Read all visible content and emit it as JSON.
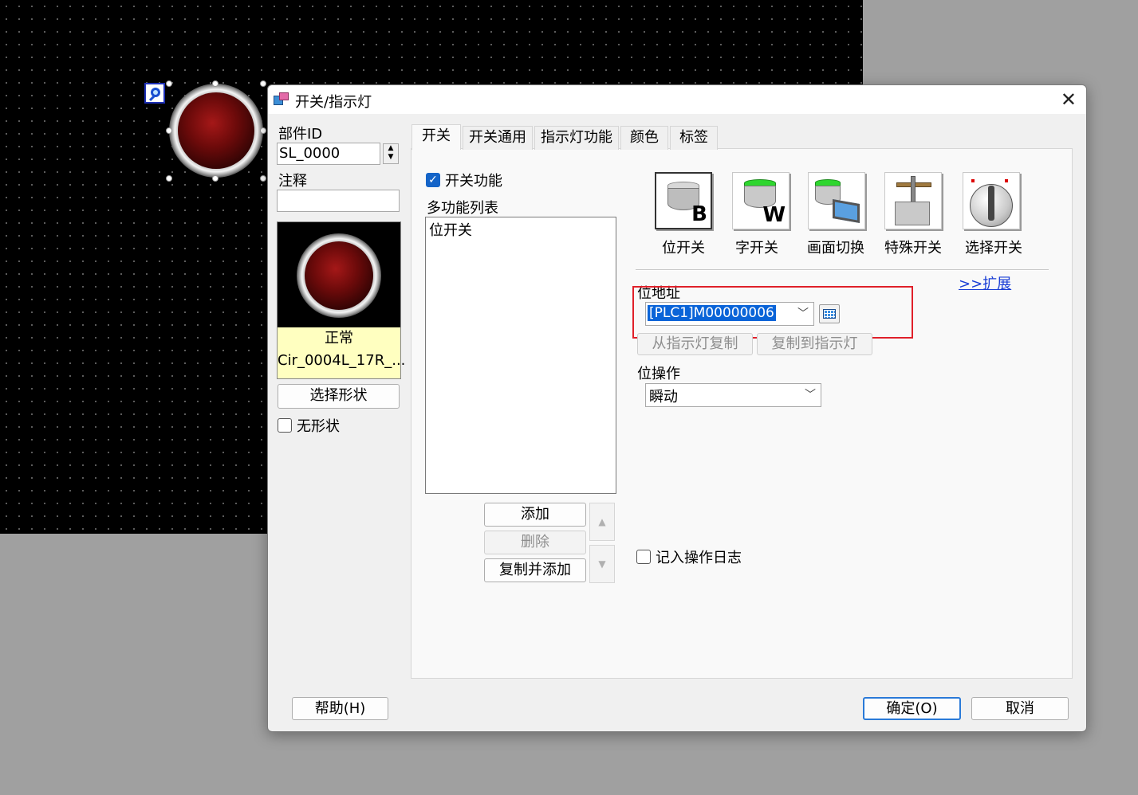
{
  "dialog": {
    "title": "开关/指示灯",
    "close_glyph": "✕"
  },
  "left_panel": {
    "part_id_label": "部件ID",
    "part_id_value": "SL_0000",
    "comment_label": "注释",
    "comment_value": "",
    "preview_state": "正常",
    "preview_shape_name": "Cir_0004L_17R_...",
    "select_shape_label": "选择形状",
    "no_shape_label": "无形状",
    "no_shape_checked": false
  },
  "tabs": [
    {
      "label": "开关",
      "active": true
    },
    {
      "label": "开关通用",
      "active": false
    },
    {
      "label": "指示灯功能",
      "active": false
    },
    {
      "label": "颜色",
      "active": false
    },
    {
      "label": "标签",
      "active": false
    }
  ],
  "switch_tab": {
    "switch_function_label": "开关功能",
    "switch_function_checked": true,
    "multi_function_list_label": "多功能列表",
    "list_items": [
      "位开关"
    ],
    "add_label": "添加",
    "delete_label": "删除",
    "copy_add_label": "复制并添加",
    "switch_types": [
      {
        "label": "位开关",
        "icon": "bit-switch-icon",
        "letter": "B",
        "selected": true
      },
      {
        "label": "字开关",
        "icon": "word-switch-icon",
        "letter": "W",
        "selected": false
      },
      {
        "label": "画面切换",
        "icon": "screen-change-icon",
        "letter": "",
        "selected": false
      },
      {
        "label": "特殊开关",
        "icon": "special-switch-icon",
        "letter": "",
        "selected": false
      },
      {
        "label": "选择开关",
        "icon": "selector-switch-icon",
        "letter": "",
        "selected": false
      }
    ],
    "expand_link": ">>扩展",
    "bit_address_label": "位地址",
    "bit_address_value": "[PLC1]M00000006",
    "copy_from_lamp_label": "从指示灯复制",
    "copy_to_lamp_label": "复制到指示灯",
    "bit_operation_label": "位操作",
    "bit_operation_value": "瞬动",
    "log_operation_label": "记入操作日志",
    "log_operation_checked": false
  },
  "footer": {
    "help_label": "帮助(H)",
    "ok_label": "确定(O)",
    "cancel_label": "取消"
  },
  "colors": {
    "highlight_box": "#e0202a",
    "selection": "#0a64d8",
    "link": "#1a3ed6",
    "canvas_bg": "#000000",
    "lamp_red": "#6b0a0a",
    "caption_bg": "#ffffc0"
  }
}
